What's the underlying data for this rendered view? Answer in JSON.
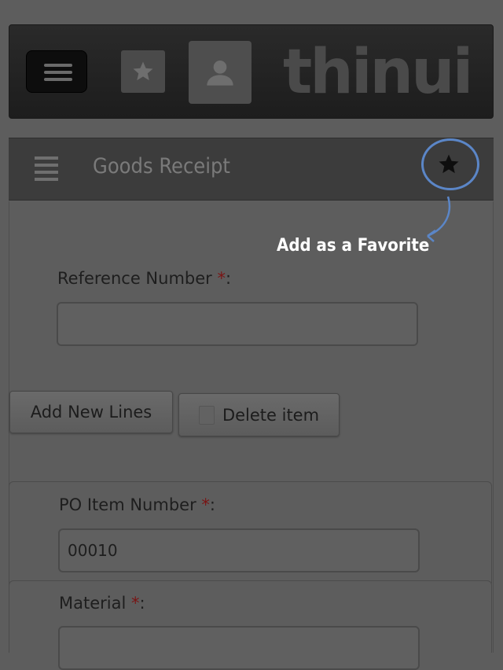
{
  "topbar": {
    "menu_icon": "hamburger-icon",
    "favorites_icon": "star-icon",
    "user_icon": "user-icon",
    "logo_text": "thinui"
  },
  "header": {
    "list_icon": "list-icon",
    "title": "Goods Receipt",
    "favorite_icon": "star-icon"
  },
  "callout": {
    "text": "Add as a Favorite",
    "highlight_color": "#5b86c7"
  },
  "form": {
    "reference_number": {
      "label": "Reference Number ",
      "required_mark": "*",
      "suffix": ":",
      "value": ""
    },
    "buttons": {
      "add_new_lines": "Add New Lines",
      "delete_item": "Delete item",
      "delete_icon": "trash-icon"
    },
    "po_item_number": {
      "label": "PO Item Number ",
      "required_mark": "*",
      "suffix": ":",
      "value": "00010"
    },
    "material": {
      "label": "Material ",
      "required_mark": "*",
      "suffix": ":",
      "value": ""
    }
  },
  "colors": {
    "page_background": "#5d5d5d",
    "required_mark": "#7a1414",
    "topbar": "#1d1d1d"
  }
}
